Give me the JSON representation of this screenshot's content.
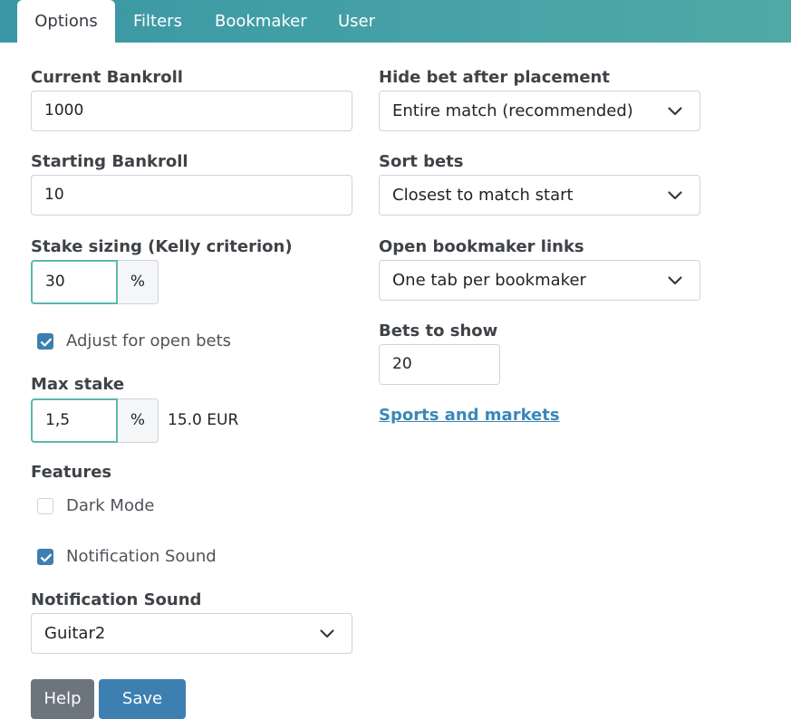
{
  "tabs": [
    {
      "label": "Options",
      "active": true
    },
    {
      "label": "Filters",
      "active": false
    },
    {
      "label": "Bookmaker",
      "active": false
    },
    {
      "label": "User",
      "active": false
    }
  ],
  "current_bankroll": {
    "label": "Current Bankroll",
    "value": "1000"
  },
  "starting_bankroll": {
    "label": "Starting Bankroll",
    "value": "10"
  },
  "stake_sizing": {
    "label": "Stake sizing (Kelly criterion)",
    "value": "30",
    "unit": "%"
  },
  "adjust_open_bets": {
    "label": "Adjust for open bets",
    "checked": true
  },
  "max_stake": {
    "label": "Max stake",
    "value": "1,5",
    "unit": "%",
    "amount": "15.0 EUR"
  },
  "features": {
    "label": "Features",
    "dark_mode": {
      "label": "Dark Mode",
      "checked": false
    },
    "notification_sound": {
      "label": "Notification Sound",
      "checked": true
    }
  },
  "notification_sound_select": {
    "label": "Notification Sound",
    "value": "Guitar2"
  },
  "hide_bet": {
    "label": "Hide bet after placement",
    "value": "Entire match (recommended)"
  },
  "sort_bets": {
    "label": "Sort bets",
    "value": "Closest to match start"
  },
  "open_links": {
    "label": "Open bookmaker links",
    "value": "One tab per bookmaker"
  },
  "bets_to_show": {
    "label": "Bets to show",
    "value": "20"
  },
  "sports_link": "Sports and markets",
  "buttons": {
    "help": "Help",
    "save": "Save"
  },
  "colors": {
    "tabbar": "#4aa3a6",
    "accent": "#5bb8ac",
    "checkbox": "#3d7fb1",
    "help_button": "#6c757d",
    "save_button": "#3d7fb1"
  }
}
